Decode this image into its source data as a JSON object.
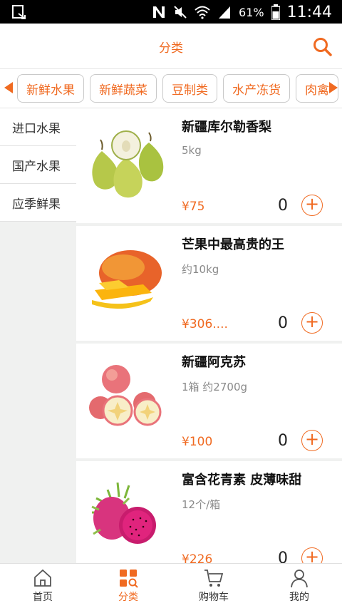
{
  "status_bar": {
    "battery": "61%",
    "time": "11:44",
    "icons": [
      "notification-icon",
      "n-icon",
      "mute-icon",
      "wifi-icon",
      "signal-icon",
      "battery-icon"
    ]
  },
  "header": {
    "title": "分类",
    "search_icon": "search-icon"
  },
  "categories": {
    "chips": [
      {
        "label": "新鲜水果"
      },
      {
        "label": "新鲜蔬菜"
      },
      {
        "label": "豆制类"
      },
      {
        "label": "水产冻货"
      },
      {
        "label": "肉禽"
      }
    ]
  },
  "sidebar": {
    "items": [
      {
        "label": "进口水果"
      },
      {
        "label": "国产水果"
      },
      {
        "label": "应季鲜果"
      }
    ]
  },
  "products": [
    {
      "name": "新疆库尔勒香梨",
      "spec": "5kg",
      "price": "¥75",
      "qty": "0",
      "image": "pear-image"
    },
    {
      "name": "芒果中最高贵的王",
      "spec": "约10kg",
      "price": "¥306....",
      "qty": "0",
      "image": "mango-image"
    },
    {
      "name": "新疆阿克苏",
      "spec": "1箱 约2700g",
      "price": "¥100",
      "qty": "0",
      "image": "apple-image"
    },
    {
      "name": "富含花青素 皮薄味甜",
      "spec": "12个/箱",
      "price": "¥226",
      "qty": "0",
      "image": "dragonfruit-image"
    }
  ],
  "tabbar": {
    "tabs": [
      {
        "label": "首页",
        "icon": "home-icon"
      },
      {
        "label": "分类",
        "icon": "category-icon"
      },
      {
        "label": "购物车",
        "icon": "cart-icon"
      },
      {
        "label": "我的",
        "icon": "user-icon"
      }
    ],
    "active": "分类"
  },
  "colors": {
    "accent": "#f06a21",
    "sidebar_bg": "#f0f1f0"
  }
}
